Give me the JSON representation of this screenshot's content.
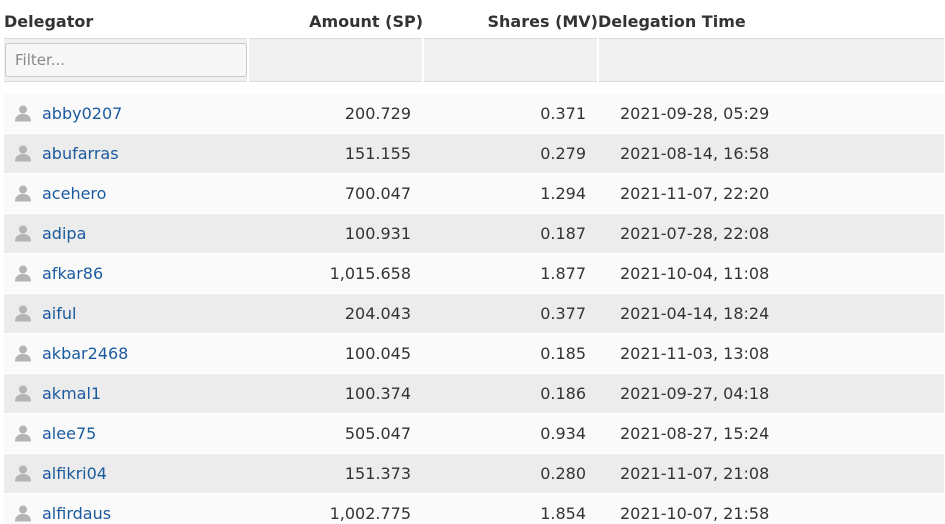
{
  "columns": {
    "delegator": "Delegator",
    "amount": "Amount (SP)",
    "shares": "Shares (MV)",
    "time": "Delegation Time"
  },
  "filter": {
    "placeholder": "Filter...",
    "value": ""
  },
  "colors": {
    "header_accent": "#2aa82a",
    "link": "#1a5a9e"
  },
  "icons": {
    "user": "user-icon"
  },
  "rows": [
    {
      "delegator": "abby0207",
      "amount": "200.729",
      "shares": "0.371",
      "time": "2021-09-28, 05:29"
    },
    {
      "delegator": "abufarras",
      "amount": "151.155",
      "shares": "0.279",
      "time": "2021-08-14, 16:58"
    },
    {
      "delegator": "acehero",
      "amount": "700.047",
      "shares": "1.294",
      "time": "2021-11-07, 22:20"
    },
    {
      "delegator": "adipa",
      "amount": "100.931",
      "shares": "0.187",
      "time": "2021-07-28, 22:08"
    },
    {
      "delegator": "afkar86",
      "amount": "1,015.658",
      "shares": "1.877",
      "time": "2021-10-04, 11:08"
    },
    {
      "delegator": "aiful",
      "amount": "204.043",
      "shares": "0.377",
      "time": "2021-04-14, 18:24"
    },
    {
      "delegator": "akbar2468",
      "amount": "100.045",
      "shares": "0.185",
      "time": "2021-11-03, 13:08"
    },
    {
      "delegator": "akmal1",
      "amount": "100.374",
      "shares": "0.186",
      "time": "2021-09-27, 04:18"
    },
    {
      "delegator": "alee75",
      "amount": "505.047",
      "shares": "0.934",
      "time": "2021-08-27, 15:24"
    },
    {
      "delegator": "alfikri04",
      "amount": "151.373",
      "shares": "0.280",
      "time": "2021-11-07, 21:08"
    },
    {
      "delegator": "alfirdaus",
      "amount": "1,002.775",
      "shares": "1.854",
      "time": "2021-10-07, 21:58"
    }
  ]
}
